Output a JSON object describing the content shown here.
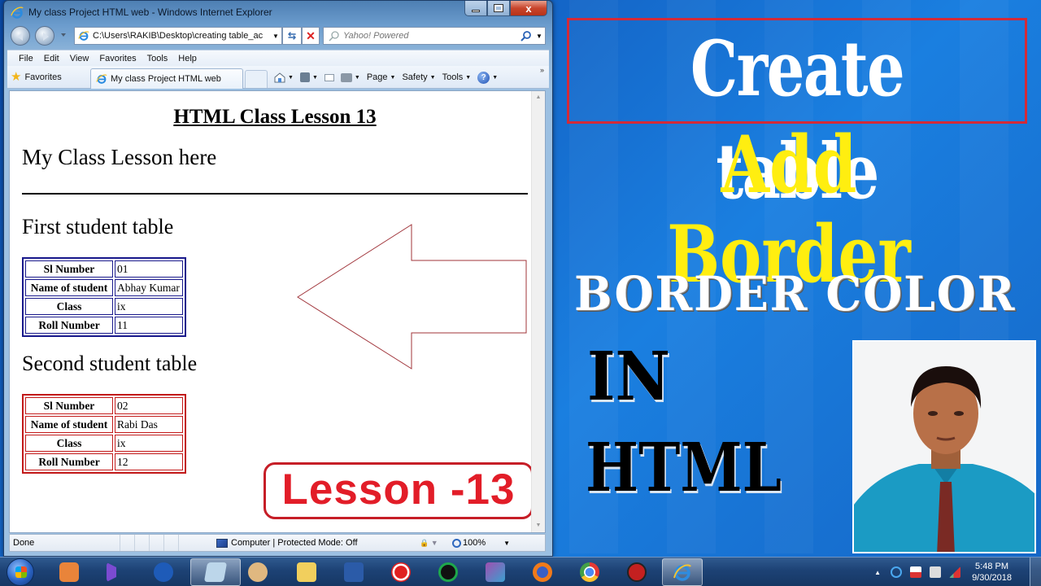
{
  "browser": {
    "window_title": "My class Project HTML web - Windows Internet Explorer",
    "address": "C:\\Users\\RAKIB\\Desktop\\creating table_ac",
    "search_placeholder": "Yahoo! Powered",
    "menu": [
      "File",
      "Edit",
      "View",
      "Favorites",
      "Tools",
      "Help"
    ],
    "favorites_label": "Favorites",
    "tab_title": "My class Project HTML web",
    "commands": {
      "page": "Page",
      "safety": "Safety",
      "tools": "Tools",
      "help": "?"
    },
    "close_glyph": "x",
    "chevron": "»",
    "status": {
      "text": "Done",
      "zone": "Computer | Protected Mode: Off",
      "zoom": "100%"
    }
  },
  "page": {
    "heading": "HTML Class Lesson 13",
    "subheading": "My Class Lesson here",
    "table1_title": "First student table",
    "table1": {
      "border_color": "#1a1a8c",
      "rows": [
        {
          "label": "Sl Number",
          "value": "01"
        },
        {
          "label": "Name of student",
          "value": "Abhay Kumar"
        },
        {
          "label": "Class",
          "value": "ix"
        },
        {
          "label": "Roll Number",
          "value": "11"
        }
      ]
    },
    "table2_title": "Second student table",
    "table2": {
      "border_color": "#c21a1a",
      "rows": [
        {
          "label": "Sl Number",
          "value": "02"
        },
        {
          "label": "Name of student",
          "value": "Rabi Das"
        },
        {
          "label": "Class",
          "value": "ix"
        },
        {
          "label": "Roll Number",
          "value": "12"
        }
      ]
    },
    "badge": "Lesson -13",
    "arrow_direction": "left"
  },
  "banner": {
    "line1": "Create table",
    "line2": "Add Border",
    "line3": "BORDER COLOR",
    "line4": "IN",
    "line5": "HTML",
    "colors": {
      "line1": "#ffffff",
      "line2": "#ffee10",
      "box_border": "#d32a38",
      "line4": "#000000"
    }
  },
  "taskbar": {
    "apps": [
      {
        "name": "media-player",
        "icon": "play-icon",
        "color": "#e9843a"
      },
      {
        "name": "visual-studio",
        "icon": "vs-icon",
        "color": "#7b4bd1"
      },
      {
        "name": "ccleaner",
        "icon": "ccleaner-icon",
        "color": "#1e5bb8"
      },
      {
        "name": "notepad",
        "icon": "notepad-icon",
        "color": "#bcd6ea",
        "active": true
      },
      {
        "name": "paint",
        "icon": "paint-icon",
        "color": "#e0b880"
      },
      {
        "name": "explorer",
        "icon": "folder-icon",
        "color": "#f1cf5d"
      },
      {
        "name": "word",
        "icon": "word-icon",
        "color": "#2b5ba8"
      },
      {
        "name": "recorder",
        "icon": "record-icon",
        "color": "#e02020"
      },
      {
        "name": "antivirus",
        "icon": "shield-icon",
        "color": "#1ea84b"
      },
      {
        "name": "winrar",
        "icon": "archive-icon",
        "color": "#a04fb0"
      },
      {
        "name": "firefox",
        "icon": "firefox-icon",
        "color": "#f07a1a"
      },
      {
        "name": "chrome",
        "icon": "chrome-icon",
        "color": "#4caf50"
      },
      {
        "name": "booster",
        "icon": "gear-icon",
        "color": "#c42020"
      },
      {
        "name": "internet-explorer",
        "icon": "ie-icon",
        "color": "#2e8ce0",
        "active": true
      }
    ],
    "time": "5:48 PM",
    "date": "9/30/2018"
  }
}
